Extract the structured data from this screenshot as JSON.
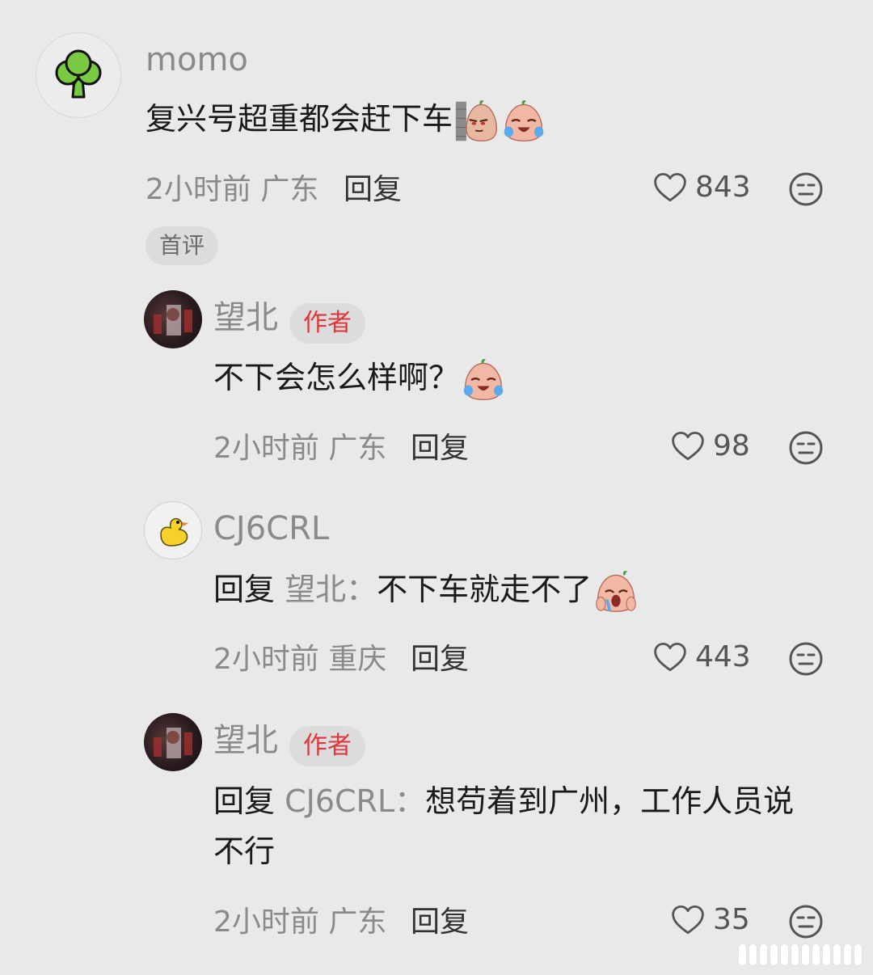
{
  "comments": [
    {
      "user": "momo",
      "text": "复兴号超重都会赶下车",
      "time": "2小时前",
      "location": "广东",
      "reply_label": "回复",
      "likes": "843",
      "first_tag": "首评",
      "avatar_icon": "broccoli-icon"
    },
    {
      "user": "望北",
      "badge": "作者",
      "text": "不下会怎么样啊？",
      "time": "2小时前",
      "location": "广东",
      "reply_label": "回复",
      "likes": "98",
      "avatar_icon": "photo-avatar"
    },
    {
      "user": "CJ6CRL",
      "reply_prefix": "回复",
      "reply_to": "望北：",
      "text": "不下车就走不了",
      "time": "2小时前",
      "location": "重庆",
      "reply_label": "回复",
      "likes": "443",
      "avatar_icon": "duck-icon"
    },
    {
      "user": "望北",
      "badge": "作者",
      "reply_prefix": "回复",
      "reply_to": "CJ6CRL：",
      "text_line1": "想苟着到广州，工作人员说",
      "text_line2": "不行",
      "time": "2小时前",
      "location": "广东",
      "reply_label": "回复",
      "likes": "35",
      "avatar_icon": "photo-avatar"
    }
  ],
  "colors": {
    "background": "#e9e9e9",
    "author_badge": "#e0353b",
    "meta_text": "#8a8a8a"
  }
}
